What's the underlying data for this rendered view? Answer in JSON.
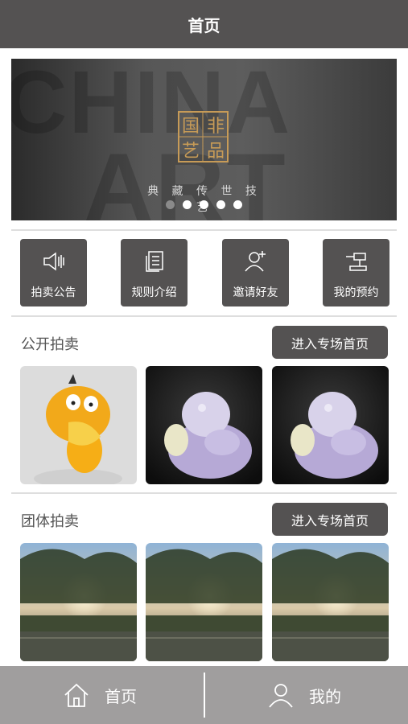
{
  "header": {
    "title": "首页"
  },
  "banner": {
    "bg_word_1": "CHINA",
    "bg_word_2": "ART",
    "seal_chars": [
      "国",
      "非",
      "艺",
      "品"
    ],
    "slogan": "典 藏 传 世 技 艺",
    "slide_count": 5,
    "active_slide": 1
  },
  "quick_actions": [
    {
      "label": "拍卖公告",
      "icon": "megaphone-icon"
    },
    {
      "label": "规则介绍",
      "icon": "document-icon"
    },
    {
      "label": "邀请好友",
      "icon": "add-user-icon"
    },
    {
      "label": "我的预约",
      "icon": "gavel-icon"
    }
  ],
  "public_auction": {
    "title": "公开拍卖",
    "button": "进入专场首页",
    "items": [
      "duck-toy-image",
      "jade-carving-image",
      "jade-carving-image"
    ]
  },
  "group_auction": {
    "title": "团体拍卖",
    "button": "进入专场首页",
    "items": [
      "sunset-tree-image",
      "sunset-tree-image",
      "sunset-tree-image"
    ]
  },
  "tabbar": {
    "home": {
      "label": "首页",
      "icon": "home-icon"
    },
    "mine": {
      "label": "我的",
      "icon": "user-icon"
    }
  },
  "colors": {
    "primary": "#545252",
    "tabbar": "#a09e9e",
    "seal": "#c79b57"
  }
}
